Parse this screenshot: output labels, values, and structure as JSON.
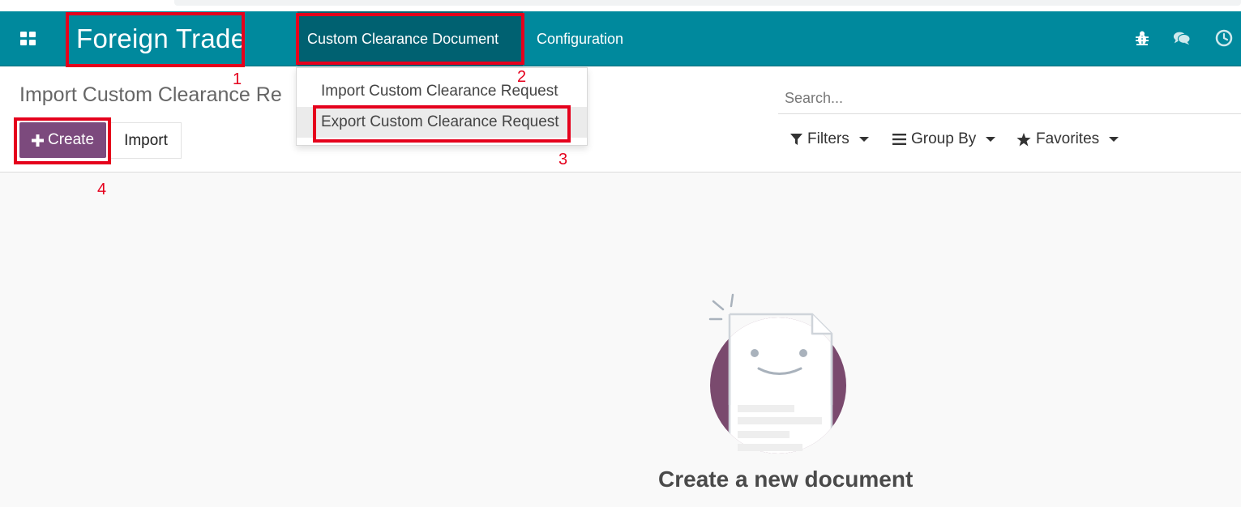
{
  "app": {
    "title": "Foreign Trade"
  },
  "navbar": {
    "menu": [
      {
        "label": "Custom Clearance Document"
      },
      {
        "label": "Configuration"
      }
    ],
    "icons": [
      "bug-icon",
      "chat-icon",
      "clock-icon"
    ],
    "color": "#00899d",
    "active_color": "#006171"
  },
  "dropdown": {
    "items": [
      {
        "label": "Import Custom Clearance Request"
      },
      {
        "label": "Export Custom Clearance Request"
      }
    ]
  },
  "control_panel": {
    "breadcrumb": "Import Custom Clearance Re",
    "create_label": "Create",
    "import_label": "Import",
    "search_placeholder": "Search...",
    "filters_label": "Filters",
    "group_by_label": "Group By",
    "favorites_label": "Favorites"
  },
  "annotations": [
    "1",
    "2",
    "3",
    "4"
  ],
  "empty_state": {
    "title": "Create a new document"
  },
  "colors": {
    "primary": "#7c4a7d",
    "highlight": "#e5001c"
  }
}
